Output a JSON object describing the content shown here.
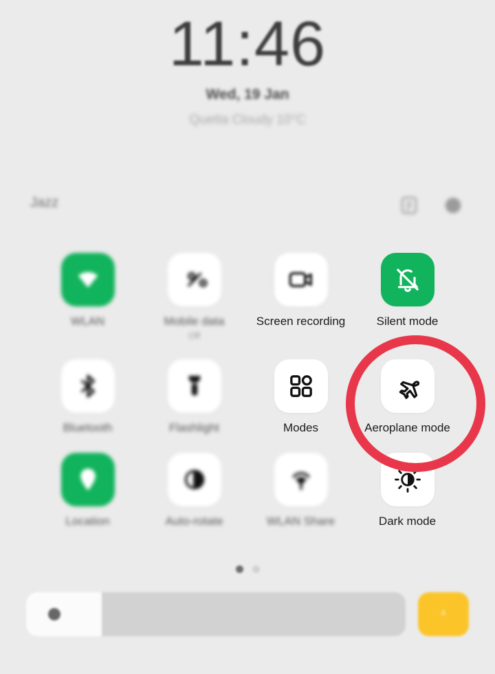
{
  "status": {
    "time": "11:46",
    "date": "Wed, 19 Jan",
    "weather": "Quetta Cloudy 10°C"
  },
  "panel": {
    "carrier": "Jazz",
    "header_icons": [
      {
        "name": "edit-icon",
        "label": "Edit"
      },
      {
        "name": "settings-gear-icon",
        "label": "Settings"
      }
    ]
  },
  "tiles": [
    {
      "label": "WLAN",
      "sublabel": "",
      "icon": "wifi-icon",
      "active": true,
      "focus": "blurred"
    },
    {
      "label": "Mobile data",
      "sublabel": "Off",
      "icon": "mobile-data-icon",
      "active": false,
      "focus": "blurred"
    },
    {
      "label": "Screen recording",
      "sublabel": "",
      "icon": "screen-record-icon",
      "active": false,
      "focus": "semi"
    },
    {
      "label": "Silent mode",
      "sublabel": "",
      "icon": "bell-slash-icon",
      "active": true,
      "focus": "sharp"
    },
    {
      "label": "Bluetooth",
      "sublabel": "",
      "icon": "bluetooth-icon",
      "active": false,
      "focus": "blurred"
    },
    {
      "label": "Flashlight",
      "sublabel": "",
      "icon": "flashlight-icon",
      "active": false,
      "focus": "blurred"
    },
    {
      "label": "Modes",
      "sublabel": "",
      "icon": "modes-grid-icon",
      "active": false,
      "focus": "sharp"
    },
    {
      "label": "Aeroplane mode",
      "sublabel": "",
      "icon": "aeroplane-icon",
      "active": false,
      "focus": "sharp"
    },
    {
      "label": "Location",
      "sublabel": "",
      "icon": "location-pin-icon",
      "active": true,
      "focus": "blurred"
    },
    {
      "label": "Auto-rotate",
      "sublabel": "",
      "icon": "auto-rotate-icon",
      "active": false,
      "focus": "blurred"
    },
    {
      "label": "WLAN Share",
      "sublabel": "",
      "icon": "hotspot-icon",
      "active": false,
      "focus": "blurred"
    },
    {
      "label": "Dark mode",
      "sublabel": "",
      "icon": "dark-mode-icon",
      "active": false,
      "focus": "sharp"
    }
  ],
  "pagination": {
    "pages": 2,
    "current": 1
  },
  "brightness": {
    "value_percent": 20,
    "icon": "brightness-icon",
    "action_button_icon": "flash-auto-icon"
  },
  "annotation": {
    "shape": "circle",
    "color": "#e8374a",
    "target": "Aeroplane mode"
  },
  "colors": {
    "background": "#ebebeb",
    "tile_off": "#ffffff",
    "tile_on": "#11b35c",
    "annotation": "#e8374a",
    "flash_button": "#fbc52a"
  }
}
